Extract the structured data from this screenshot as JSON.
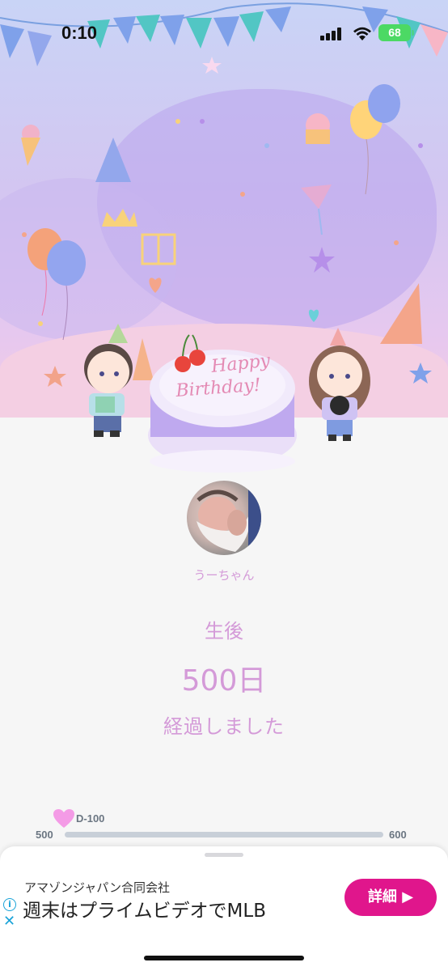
{
  "status_bar": {
    "time": "0:10",
    "battery": "68"
  },
  "profile": {
    "name": "うーちゃん"
  },
  "counter": {
    "label_before": "生後",
    "value": "500日",
    "label_after": "経過しました"
  },
  "progress": {
    "marker_label": "D-100",
    "min_label": "500",
    "max_label": "600",
    "fraction": 0.0
  },
  "ad": {
    "company": "アマゾンジャパン合同会社",
    "headline": "週末はプライムビデオでMLB",
    "cta": "詳細 ▶",
    "info_glyph": "i",
    "close_glyph": "✕"
  },
  "colors": {
    "accent": "#d49ad8",
    "ad_button": "#e0168c",
    "battery": "#4cd964"
  }
}
